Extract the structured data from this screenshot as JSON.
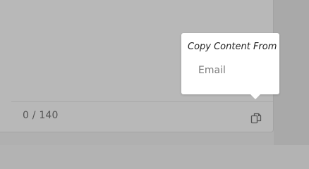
{
  "editor": {
    "char_counter": "0 / 140",
    "copy_button_icon": "copy-icon"
  },
  "copy_popover": {
    "title": "Copy Content From",
    "options": [
      {
        "label": "Email"
      }
    ]
  },
  "colors": {
    "backdrop": "#b0b0b0",
    "panel": "#b8b8b8",
    "popover_bg": "#ffffff",
    "counter_text": "#555555",
    "option_text": "#7a7a7a"
  }
}
